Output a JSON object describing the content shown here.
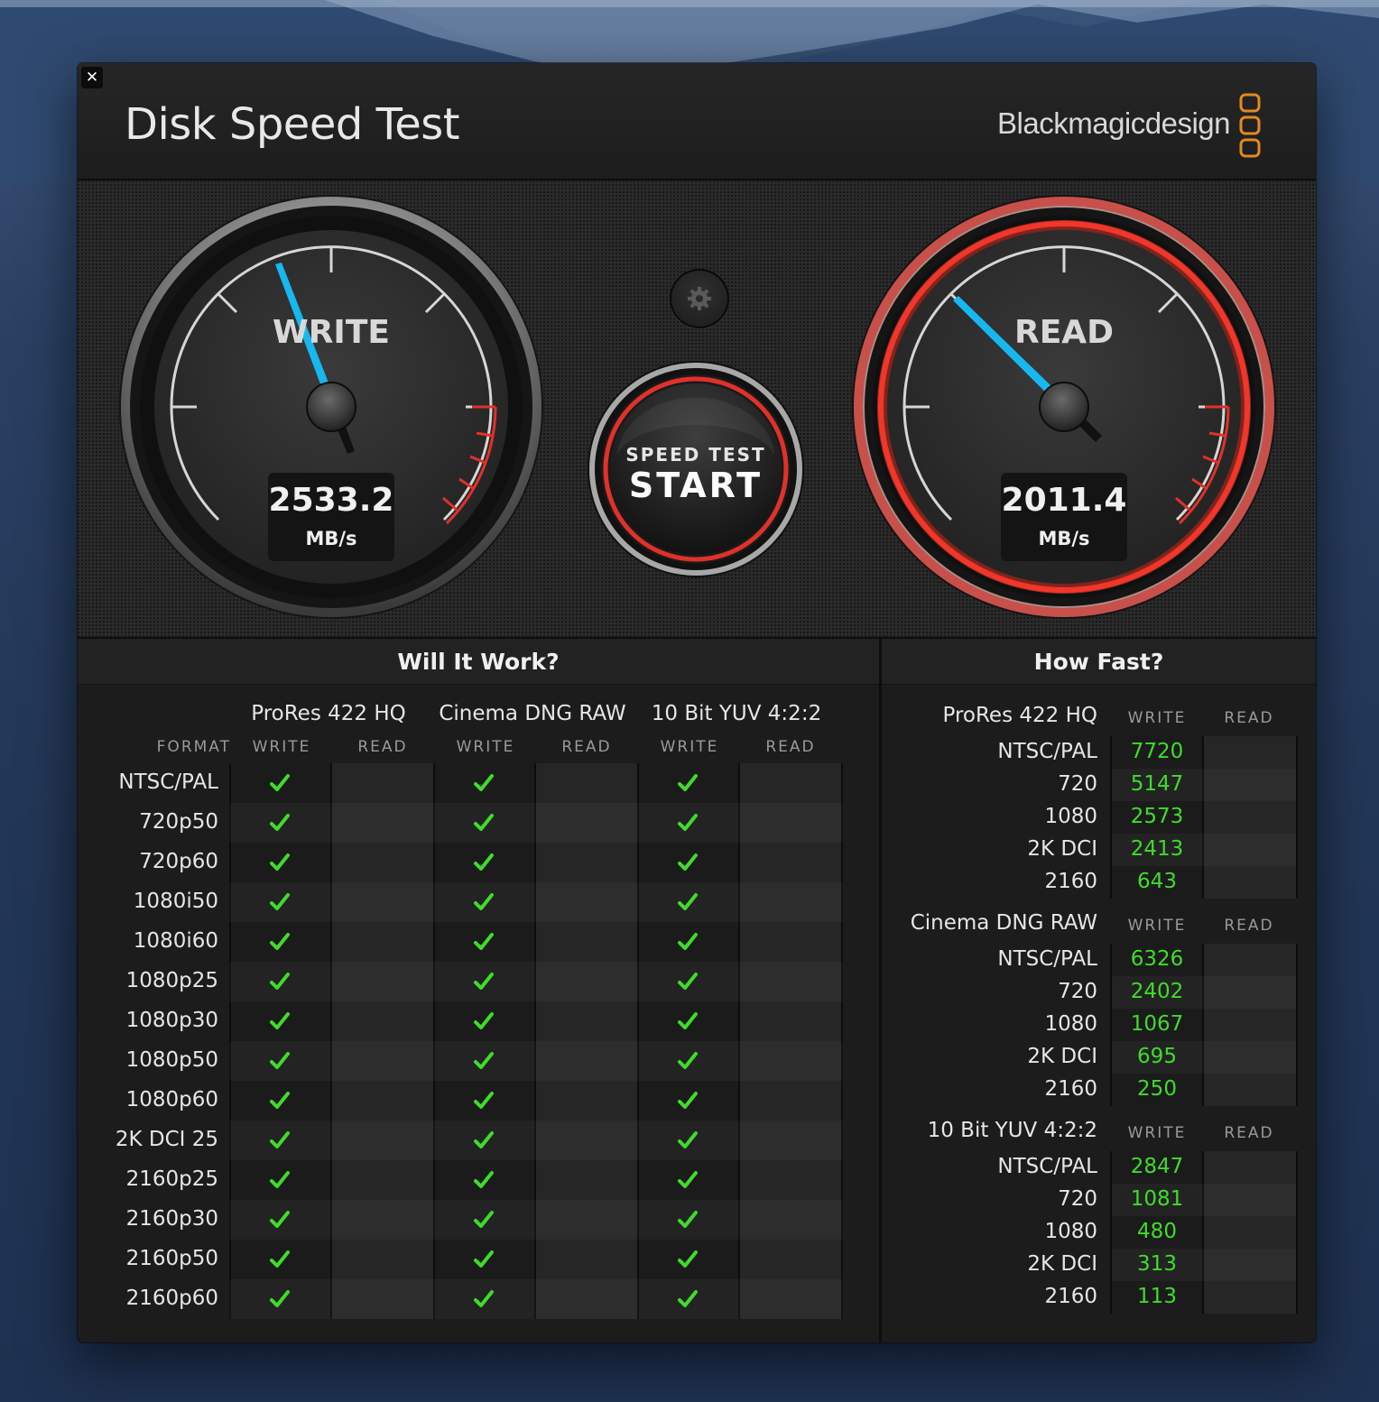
{
  "window": {
    "title": "Disk Speed Test",
    "brand": "Blackmagicdesign",
    "close_icon": "close-icon"
  },
  "gauges": {
    "write": {
      "title": "WRITE",
      "value": "2533.2",
      "unit": "MB/s"
    },
    "read": {
      "title": "READ",
      "value": "2011.4",
      "unit": "MB/s"
    }
  },
  "start_button": {
    "top_label": "SPEED TEST",
    "main_label": "START"
  },
  "will_it_work": {
    "heading": "Will It Work?",
    "format_label": "FORMAT",
    "groups": [
      "ProRes 422 HQ",
      "Cinema DNG RAW",
      "10 Bit YUV 4:2:2"
    ],
    "sub_headers": [
      "WRITE",
      "READ"
    ],
    "rows": [
      "NTSC/PAL",
      "720p50",
      "720p60",
      "1080i50",
      "1080i60",
      "1080p25",
      "1080p30",
      "1080p50",
      "1080p60",
      "2K DCI 25",
      "2160p25",
      "2160p30",
      "2160p50",
      "2160p60"
    ]
  },
  "how_fast": {
    "heading": "How Fast?",
    "sub_headers": [
      "WRITE",
      "READ"
    ],
    "groups": [
      {
        "name": "ProRes 422 HQ",
        "rows": [
          {
            "label": "NTSC/PAL",
            "write": "7720",
            "read": ""
          },
          {
            "label": "720",
            "write": "5147",
            "read": ""
          },
          {
            "label": "1080",
            "write": "2573",
            "read": ""
          },
          {
            "label": "2K DCI",
            "write": "2413",
            "read": ""
          },
          {
            "label": "2160",
            "write": "643",
            "read": ""
          }
        ]
      },
      {
        "name": "Cinema DNG RAW",
        "rows": [
          {
            "label": "NTSC/PAL",
            "write": "6326",
            "read": ""
          },
          {
            "label": "720",
            "write": "2402",
            "read": ""
          },
          {
            "label": "1080",
            "write": "1067",
            "read": ""
          },
          {
            "label": "2K DCI",
            "write": "695",
            "read": ""
          },
          {
            "label": "2160",
            "write": "250",
            "read": ""
          }
        ]
      },
      {
        "name": "10 Bit YUV 4:2:2",
        "rows": [
          {
            "label": "NTSC/PAL",
            "write": "2847",
            "read": ""
          },
          {
            "label": "720",
            "write": "1081",
            "read": ""
          },
          {
            "label": "1080",
            "write": "480",
            "read": ""
          },
          {
            "label": "2K DCI",
            "write": "313",
            "read": ""
          },
          {
            "label": "2160",
            "write": "113",
            "read": ""
          }
        ]
      }
    ]
  },
  "colors": {
    "accent_red": "#e0312a",
    "needle_blue": "#17b7ef",
    "check_green": "#3fdc2a",
    "brand_orange": "#e38a1f"
  }
}
